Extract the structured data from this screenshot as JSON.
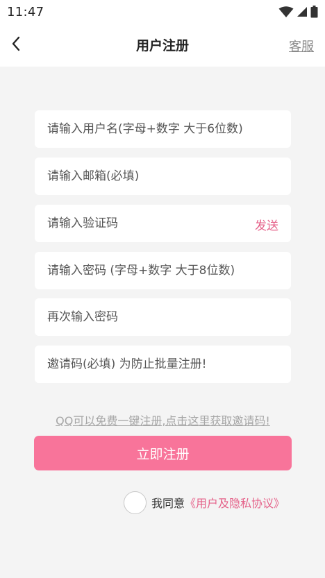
{
  "status_bar": {
    "time": "11:47"
  },
  "header": {
    "title": "用户注册",
    "service_label": "客服"
  },
  "form": {
    "username": {
      "placeholder": "请输入用户名(字母+数字 大于6位数)",
      "value": ""
    },
    "email": {
      "placeholder": "请输入邮箱(必填)",
      "value": ""
    },
    "code": {
      "placeholder": "请输入验证码",
      "value": "",
      "send_label": "发送"
    },
    "password": {
      "placeholder": "请输入密码 (字母+数字 大于8位数)",
      "value": ""
    },
    "password_confirm": {
      "placeholder": "再次输入密码",
      "value": ""
    },
    "invite": {
      "placeholder": "邀请码(必填) 为防止批量注册!",
      "value": ""
    }
  },
  "qq_tip": "QQ可以免费一键注册,点击这里获取邀请码!",
  "register_label": "立即注册",
  "agreement": {
    "prefix": "我同意",
    "link": "《用户及隐私协议》",
    "checked": false
  },
  "colors": {
    "accent": "#f8749a",
    "link": "#e56189",
    "background": "#f4f4f4"
  },
  "icons": [
    "wifi-icon",
    "signal-icon",
    "battery-icon",
    "back-arrow-icon"
  ]
}
